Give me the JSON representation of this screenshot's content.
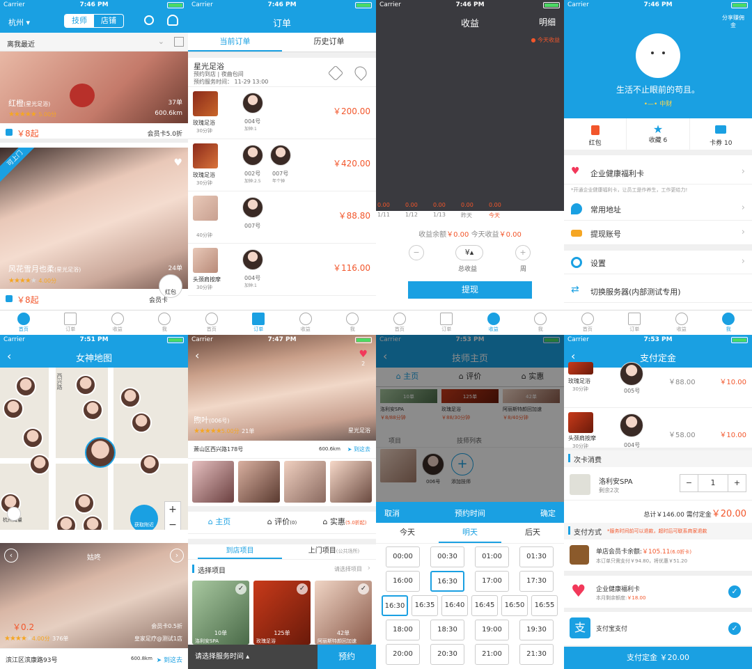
{
  "status": {
    "carrier": "Carrier",
    "t1": "7:46 PM",
    "t2": "7:51 PM",
    "t3": "7:47 PM",
    "t4": "7:53 PM"
  },
  "colors": {
    "accent": "#1aa0e2",
    "price": "#f2562b",
    "star": "#f5a623"
  },
  "home": {
    "city": "杭州",
    "tab_tech": "技师",
    "tab_store": "店铺",
    "sort": "离我最近",
    "card1": {
      "name": "红橙",
      "store": "(星光足浴)",
      "orders": "37单",
      "rating": "5.00分",
      "dist": "600.6km",
      "price": "￥8起",
      "member": "会员卡5.0折"
    },
    "card2": {
      "badge": "可上门",
      "name": "风花雪月也柔",
      "store": "(星光足浴)",
      "orders": "24单",
      "rating": "4.00分",
      "price": "￥8起",
      "member": "会员卡",
      "redpack": "红包"
    }
  },
  "tabs": {
    "home": "首页",
    "order": "订单",
    "income": "收益",
    "me": "我"
  },
  "orders": {
    "title": "订单",
    "tab_current": "当前订单",
    "tab_history": "历史订单",
    "store": "星光足浴",
    "line1": "预约到店 | 夜曲包间",
    "line2": "预约服务时间： 11-29 13:00",
    "items": [
      {
        "svc": "玫瑰足浴",
        "dur": "30分钟",
        "techs": [
          {
            "no": "004号",
            "note": "加钟:1"
          }
        ],
        "price": "￥200.00"
      },
      {
        "svc": "玫瑰足浴",
        "dur": "30分钟",
        "techs": [
          {
            "no": "002号",
            "note": "加钟:2.5"
          },
          {
            "no": "007号",
            "note": "年个钟"
          }
        ],
        "price": "￥420.00"
      },
      {
        "svc": "",
        "dur": "40分钟",
        "techs": [
          {
            "no": "007号",
            "note": ""
          }
        ],
        "price": "￥88.80"
      },
      {
        "svc": "头颈肩按摩",
        "dur": "30分钟",
        "techs": [
          {
            "no": "004号",
            "note": "加钟:1"
          }
        ],
        "price": "￥116.00"
      }
    ]
  },
  "income": {
    "title": "收益",
    "detail": "明细",
    "legend": "今天收益",
    "vals": [
      "0.00",
      "0.00",
      "0.00",
      "0.00",
      "0.00"
    ],
    "dates": [
      "1/11",
      "1/12",
      "1/13",
      "昨天",
      "今天"
    ],
    "balance_label": "收益余额",
    "balance": "￥0.00",
    "today_label": "今天收益",
    "today": "￥0.00",
    "total": "总收益",
    "week": "周",
    "withdraw": "提现"
  },
  "me": {
    "share": "分享赚佣金",
    "slogan": "生活不止眼前的苟且。",
    "sub": "中财",
    "stats": [
      {
        "label": "红包"
      },
      {
        "label": "收藏 6"
      },
      {
        "label": "卡券 10"
      }
    ],
    "card": "企业健康福利卡",
    "card_note": "*开通企业健康福利卡，让员工是作养生，工作更给力!",
    "addr": "常用地址",
    "account": "提现账号",
    "settings": "设置",
    "server": "切换服务器(内部测试专用)"
  },
  "map": {
    "title": "女神地图",
    "road1": "西兴路",
    "store1": "杭州海量",
    "near": "获取附近",
    "card_name": "姑咚",
    "price": "￥0.2",
    "rating": "4.00分",
    "orders": "376单",
    "member": "会员卡0.5折",
    "store": "皇家足疗@测试1店",
    "addr": "滨江区滨康路93号",
    "dist": "600.8km",
    "go": "到这去"
  },
  "tech": {
    "name": "煦叶",
    "no": "(006号)",
    "rating": "5.00分",
    "orders": "21单",
    "store": "星光足浴",
    "likes": "2",
    "addr": "萧山区西兴路178号",
    "dist": "600.6km",
    "go": "到这去",
    "tab_home": "主页",
    "tab_review": "评价",
    "review_n": "(0)",
    "tab_deal": "实惠",
    "deal_n": "(5.0折起)",
    "visit_store": "到店项目",
    "visit_home": "上门项目",
    "visit_home_sub": "(公共场所)",
    "select": "选择项目",
    "select_hint": "请选择项目",
    "items": [
      {
        "orders": "10单",
        "name": "洛利安SPA"
      },
      {
        "orders": "125单",
        "name": "玫瑰足浴",
        "price": "￥88/30分钟"
      },
      {
        "orders": "42单",
        "name": "阿丽斯特颜回加速"
      }
    ],
    "choose_time": "请选择服务时间",
    "book": "预约"
  },
  "booking": {
    "title": "技师主页",
    "cancel": "取消",
    "head": "预约时间",
    "ok": "确定",
    "days": [
      "今天",
      "明天",
      "后天"
    ],
    "times": [
      [
        "00:00",
        "00:30",
        "01:00",
        "01:30"
      ],
      [
        "16:00",
        "16:30",
        "17:00",
        "17:30"
      ],
      [
        "16:30",
        "16:35",
        "16:40",
        "16:45",
        "16:50",
        "16:55"
      ],
      [
        "18:00",
        "18:30",
        "19:00",
        "19:30"
      ],
      [
        "20:00",
        "20:30",
        "21:00",
        "21:30"
      ]
    ],
    "bg_items": [
      "10单",
      "125单",
      "42单"
    ],
    "bg_names": [
      "洛利安SPA",
      "玫瑰足浴",
      "阿丽斯特颜回加速"
    ],
    "bg_prices": [
      "￥8/88分钟",
      "￥88/30分钟",
      "￥8/40分钟"
    ],
    "tab_home": "主页",
    "tab_review": "评价",
    "tab_deal": "实惠",
    "project": "项目",
    "techlist": "技师列表",
    "tech_no": "006号",
    "add_tech": "添加技师"
  },
  "pay": {
    "title": "支付定金",
    "rows": [
      {
        "svc": "玫瑰足浴",
        "dur": "30分钟",
        "no": "005号",
        "price": "￥88.00",
        "deposit": "￥10.00"
      },
      {
        "svc": "头颈肩按摩",
        "dur": "30分钟",
        "no": "004号",
        "price": "￥58.00",
        "deposit": "￥10.00"
      }
    ],
    "card_title": "次卡消费",
    "card_name": "洛利安SPA",
    "card_left": "剩余2次",
    "qty": "1",
    "total_label": "总计",
    "total": "￥146.00",
    "need_label": "需付定金",
    "need": "￥20.00",
    "method": "支付方式",
    "method_note": "*服务时间前可以退款，超时后可联系商家退款",
    "m1": "单店会员卡余额:",
    "m1v": "￥105.11",
    "m1d": "(6.0折卡)",
    "m1sub": "本订单只需支付￥94.80，将优惠￥51.20",
    "m2": "企业健康福利卡",
    "m2sub": "本月剩余额度:",
    "m2v": "￥18.00",
    "m3": "支付宝支付",
    "btn": "支付定金 ￥20.00"
  }
}
